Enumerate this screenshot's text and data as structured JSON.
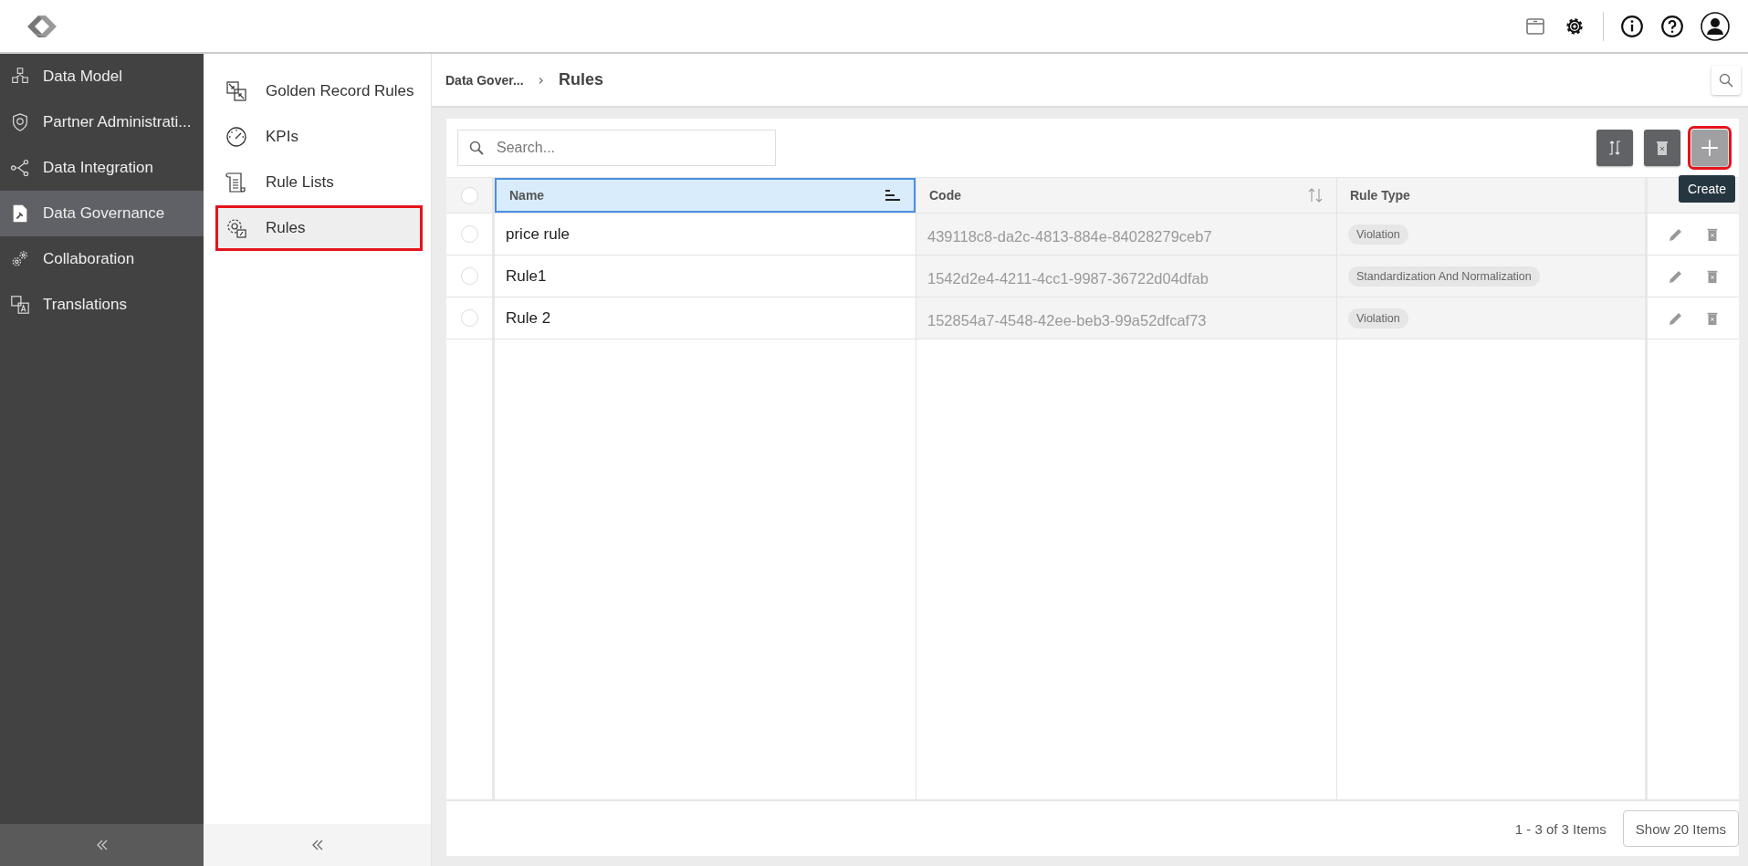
{
  "header": {
    "icons": [
      {
        "kind": "package"
      },
      {
        "kind": "settings"
      },
      {
        "kind": "info"
      },
      {
        "kind": "help"
      },
      {
        "kind": "user"
      }
    ]
  },
  "sidebar": {
    "items": [
      {
        "label": "Data Model",
        "kind": "cubes",
        "selected": false
      },
      {
        "label": "Partner Administrati...",
        "kind": "shield",
        "selected": false
      },
      {
        "label": "Data Integration",
        "kind": "nodes",
        "selected": false
      },
      {
        "label": "Data Governance",
        "kind": "gavel",
        "selected": true
      },
      {
        "label": "Collaboration",
        "kind": "gears",
        "selected": false
      },
      {
        "label": "Translations",
        "kind": "translate",
        "selected": false
      }
    ]
  },
  "subnav": {
    "items": [
      {
        "label": "Golden Record Rules",
        "kind": "merge",
        "selected": false,
        "highlighted": false
      },
      {
        "label": "KPIs",
        "kind": "gauge",
        "selected": false,
        "highlighted": false
      },
      {
        "label": "Rule Lists",
        "kind": "scroll",
        "selected": false,
        "highlighted": false
      },
      {
        "label": "Rules",
        "kind": "gear",
        "selected": true,
        "highlighted": true
      }
    ]
  },
  "breadcrumb": {
    "parent": "Data Gover...",
    "separator": "›",
    "current": "Rules"
  },
  "toolbar": {
    "search": {
      "placeholder": "Search..."
    },
    "buttons": [
      {
        "kind": "refresh",
        "highlighted": false
      },
      {
        "kind": "delete",
        "highlighted": false
      },
      {
        "kind": "create",
        "highlighted": true,
        "tooltip": "Create"
      }
    ]
  },
  "table": {
    "select_all": {
      "selected": false
    },
    "columns": [
      {
        "label": "Name",
        "selected": true,
        "kind": "sorted"
      },
      {
        "label": "Code",
        "selected": false,
        "kind": "sortable"
      },
      {
        "label": "Rule Type",
        "selected": false,
        "kind": "plain"
      }
    ],
    "rows": [
      {
        "selected": false,
        "name": "price rule",
        "code": "439118c8-da2c-4813-884e-84028279ceb7",
        "rule_type": "Violation"
      },
      {
        "selected": false,
        "name": "Rule1",
        "code": "1542d2e4-4211-4cc1-9987-36722d04dfab",
        "rule_type": "Standardization And Normalization"
      },
      {
        "selected": false,
        "name": "Rule 2",
        "code": "152854a7-4548-42ee-beb3-99a52dfcaf73",
        "rule_type": "Violation"
      }
    ]
  },
  "footer": {
    "summary": "1 - 3 of 3 Items",
    "page_size_button": "Show 20 Items"
  }
}
